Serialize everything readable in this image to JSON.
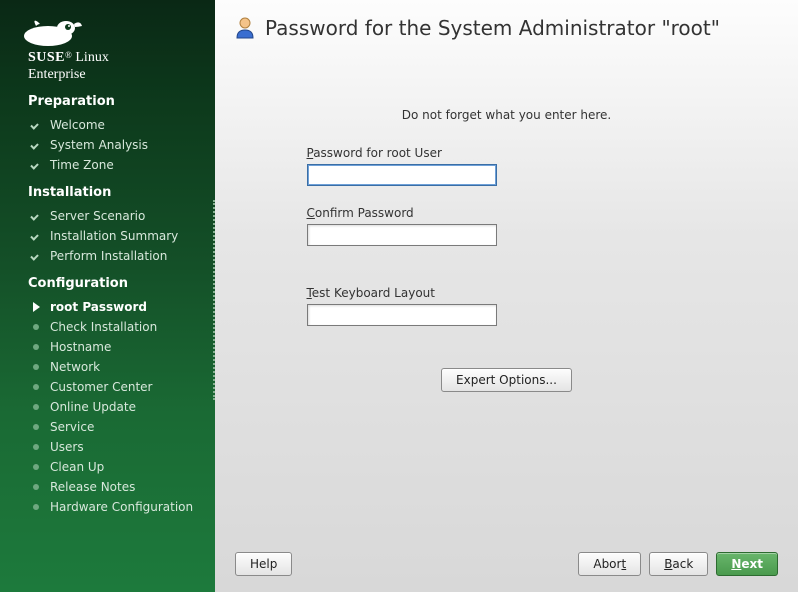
{
  "brand": {
    "name": "SUSE",
    "suffix": "Linux",
    "line2": "Enterprise"
  },
  "sections": {
    "preparation": {
      "title": "Preparation",
      "items": [
        {
          "label": "Welcome",
          "status": "done"
        },
        {
          "label": "System Analysis",
          "status": "done"
        },
        {
          "label": "Time Zone",
          "status": "done"
        }
      ]
    },
    "installation": {
      "title": "Installation",
      "items": [
        {
          "label": "Server Scenario",
          "status": "done"
        },
        {
          "label": "Installation Summary",
          "status": "done"
        },
        {
          "label": "Perform Installation",
          "status": "done"
        }
      ]
    },
    "configuration": {
      "title": "Configuration",
      "items": [
        {
          "label": "root Password",
          "status": "current"
        },
        {
          "label": "Check Installation",
          "status": "pending"
        },
        {
          "label": "Hostname",
          "status": "pending"
        },
        {
          "label": "Network",
          "status": "pending"
        },
        {
          "label": "Customer Center",
          "status": "pending"
        },
        {
          "label": "Online Update",
          "status": "pending"
        },
        {
          "label": "Service",
          "status": "pending"
        },
        {
          "label": "Users",
          "status": "pending"
        },
        {
          "label": "Clean Up",
          "status": "pending"
        },
        {
          "label": "Release Notes",
          "status": "pending"
        },
        {
          "label": "Hardware Configuration",
          "status": "pending"
        }
      ]
    }
  },
  "page": {
    "title": "Password for the System Administrator \"root\"",
    "hint": "Do not forget what you enter here.",
    "password_label_pre": "P",
    "password_label_rest": "assword for root User",
    "confirm_label_pre": "C",
    "confirm_label_rest": "onfirm Password",
    "test_label_pre": "T",
    "test_label_rest": "est Keyboard Layout",
    "password_value": "",
    "confirm_value": "",
    "test_value": "",
    "expert_btn": "Expert Options..."
  },
  "footer": {
    "help": "Help",
    "abort_pre": "Abor",
    "abort_u": "t",
    "back_u": "B",
    "back_rest": "ack",
    "next_u": "N",
    "next_rest": "ext"
  }
}
